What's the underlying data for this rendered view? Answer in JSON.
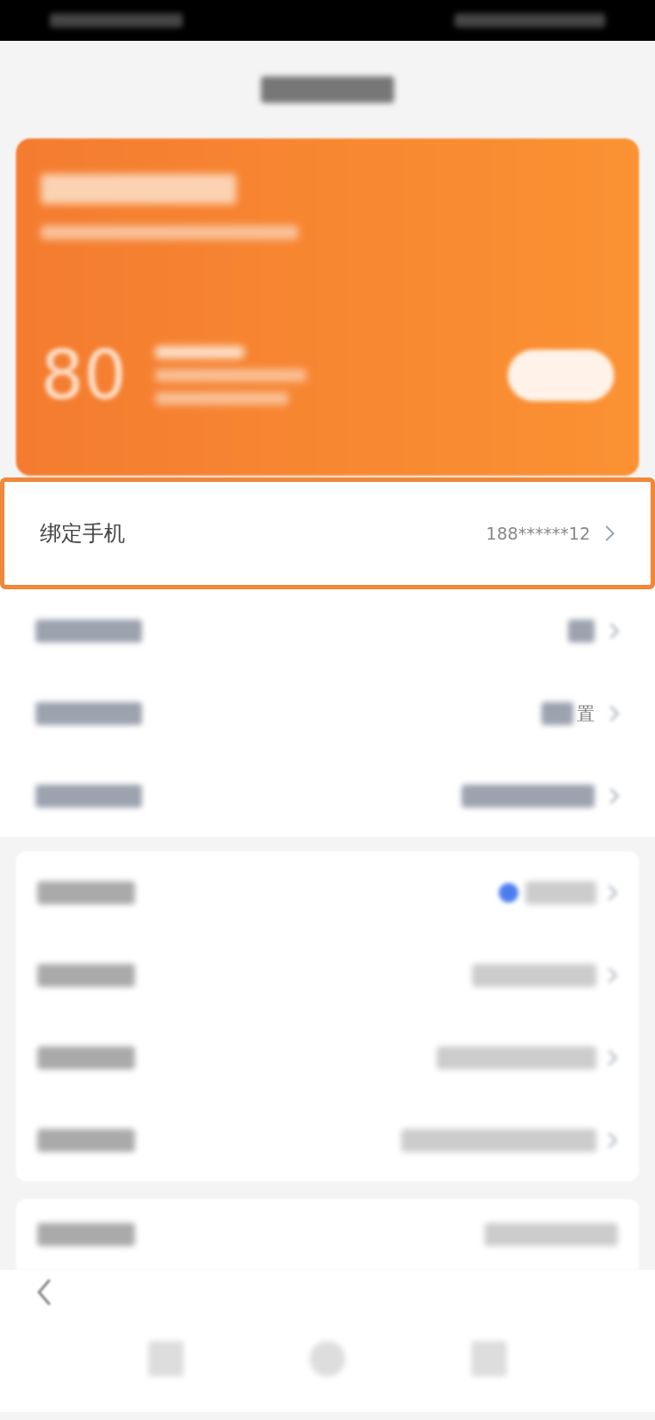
{
  "card": {
    "points": "80"
  },
  "highlight_row": {
    "label": "绑定手机",
    "value": "188******12"
  },
  "rows": [
    {
      "kind": "blurred",
      "value": ""
    },
    {
      "kind": "partial",
      "value": "置"
    },
    {
      "kind": "blurred",
      "value": ""
    }
  ],
  "settings": [
    {
      "kind": "toggle",
      "on": true
    },
    {
      "kind": "plain"
    },
    {
      "kind": "plain"
    },
    {
      "kind": "plain"
    }
  ]
}
